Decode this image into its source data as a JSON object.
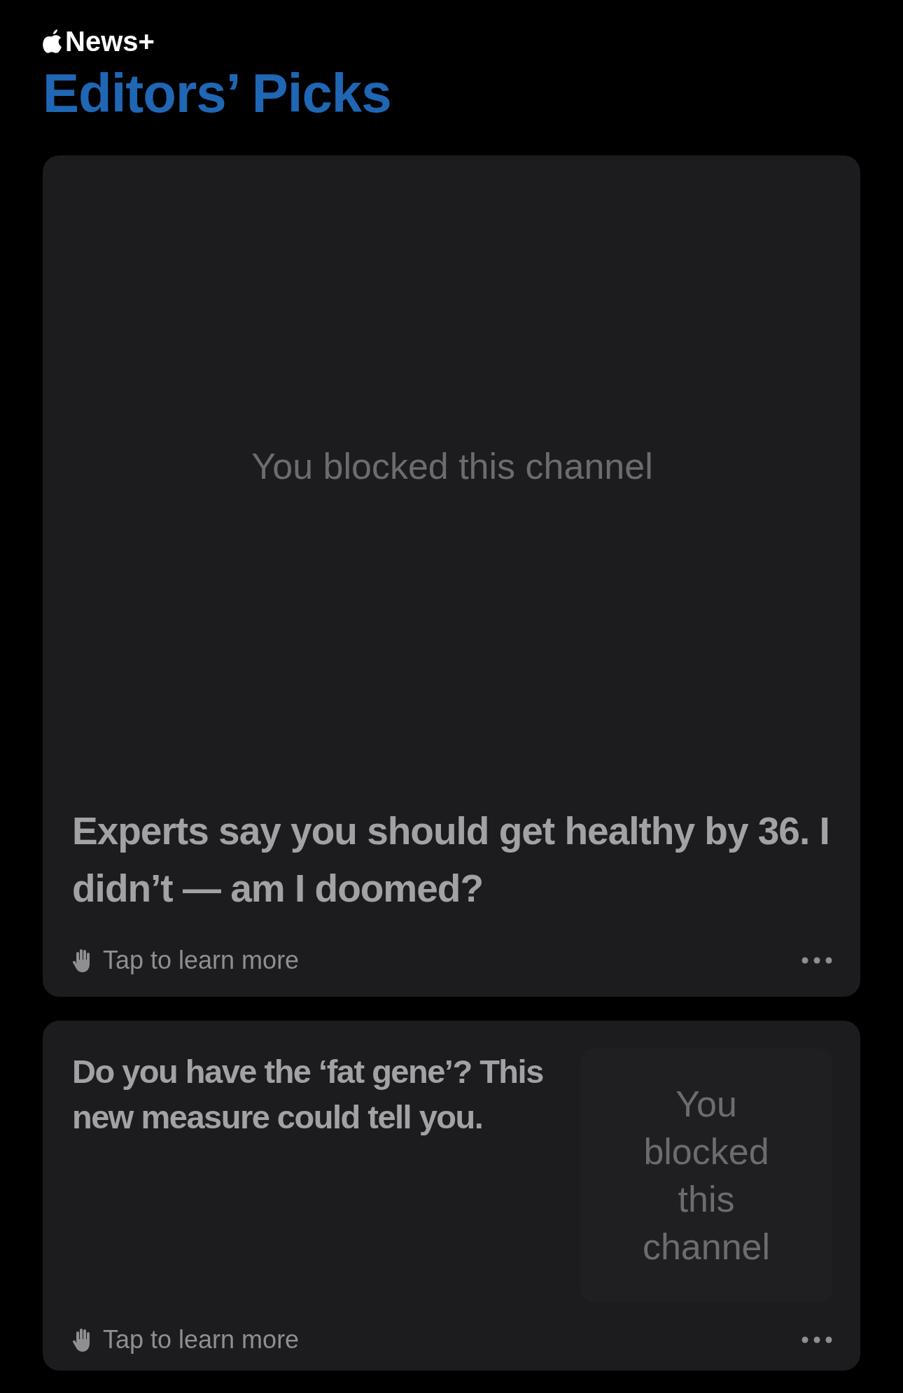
{
  "header": {
    "brand": "News+",
    "title": "Editors’ Picks"
  },
  "cards": [
    {
      "kind": "large",
      "blocked_message": "You blocked this channel",
      "headline": "Experts say you should get healthy by 36. I didn’t — am I doomed?",
      "footer_link": "Tap to learn more"
    },
    {
      "kind": "compact",
      "blocked_message": "You blocked this channel",
      "headline": "Do you have the ‘fat gene’? This new measure could tell you.",
      "footer_link": "Tap to learn more"
    }
  ]
}
